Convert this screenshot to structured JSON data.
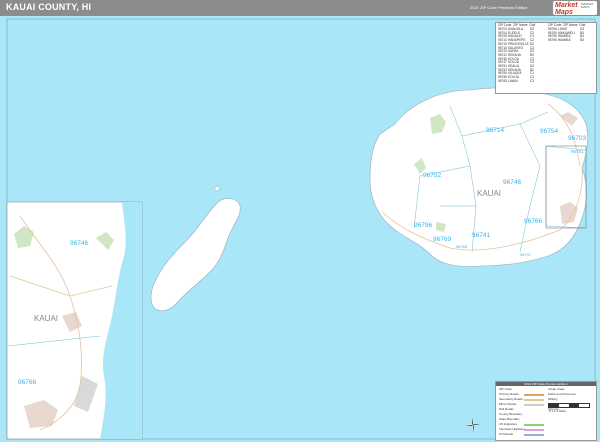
{
  "header": {
    "title": "KAUAI COUNTY, HI",
    "edition": "2021 ZIP Code Premium Edition",
    "logo_text": "Market Maps",
    "logo_sub": "MARKET MAPS"
  },
  "map": {
    "colors": {
      "water": "#a8e6f8",
      "land": "#ffffff",
      "zip_label": "#39b3e6",
      "boundary": "#6fb8d6",
      "road": "#e3c39a",
      "park": "#cfe7c4",
      "urban": "#e8d8d0"
    },
    "island_label": "KAUAI",
    "inset_island_label": "KAUAI",
    "zip_labels": [
      {
        "name": "zip-96714",
        "text": "96714"
      },
      {
        "name": "zip-96754",
        "text": "96754"
      },
      {
        "name": "zip-96703",
        "text": "96703"
      },
      {
        "name": "zip-96751",
        "text": "96751"
      },
      {
        "name": "zip-96752",
        "text": "96752"
      },
      {
        "name": "zip-96746",
        "text": "96746"
      },
      {
        "name": "zip-96796",
        "text": "96796"
      },
      {
        "name": "zip-96769",
        "text": "96769"
      },
      {
        "name": "zip-96741",
        "text": "96741"
      },
      {
        "name": "zip-96766",
        "text": "96766"
      },
      {
        "name": "zip-96765",
        "text": "96765"
      },
      {
        "name": "zip-96747",
        "text": "96747"
      },
      {
        "name": "inset-zip-96746",
        "text": "96746"
      },
      {
        "name": "inset-zip-96766",
        "text": "96766"
      }
    ]
  },
  "zip_table": {
    "headers": [
      "ZIP Code",
      "ZIP Name",
      "Grid",
      "ZIP Code",
      "ZIP Name",
      "Grid"
    ],
    "rows_left": [
      [
        "96703",
        "ANAHOLA",
        "D2"
      ],
      [
        "96704",
        "ELEELE",
        "C3"
      ],
      [
        "96705",
        "HANALEI",
        "C1"
      ],
      [
        "96714",
        "HANAPEPE",
        "C2"
      ],
      [
        "96715",
        "PRINCEVILLE",
        "D2"
      ],
      [
        "96716",
        "KALAHEO",
        "C3"
      ],
      [
        "96722",
        "KAPAA",
        "D2"
      ],
      [
        "96741",
        "KEKAHA",
        "B3"
      ],
      [
        "96746",
        "KOLOA",
        "C3"
      ],
      [
        "96747",
        "KOLOA",
        "C3"
      ],
      [
        "96751",
        "KEALIA",
        "D2"
      ],
      [
        "96752",
        "KEKAHA",
        "B2"
      ],
      [
        "96754",
        "KILAUEA",
        "C1"
      ],
      [
        "96756",
        "KOLOA",
        "C3"
      ],
      [
        "96765",
        "LAWAI",
        "C3"
      ]
    ],
    "rows_right": [
      [
        "96766",
        "LIHUE",
        "D3"
      ],
      [
        "96769",
        "MAKAWELI",
        "B3"
      ],
      [
        "96796",
        "WAIMEA",
        "B3"
      ],
      [
        "96796",
        "WAIMEA",
        "B3"
      ]
    ]
  },
  "legend": {
    "title": "2021 ZIP Code Premium Edition",
    "rows": [
      "ZIP Code",
      "Primary Roads",
      "Secondary Roads",
      "Minor Roads",
      "Rail Roads",
      "County Boundary",
      "State Boundary",
      "US Highways",
      "Interstate Highways",
      "Toll Roads"
    ],
    "right_rows": [
      "Urban Areas",
      "Parks and Preserves",
      "Military",
      "Indian Reservations",
      "Airports"
    ],
    "scale_label": "0   1   2   4 Miles"
  }
}
